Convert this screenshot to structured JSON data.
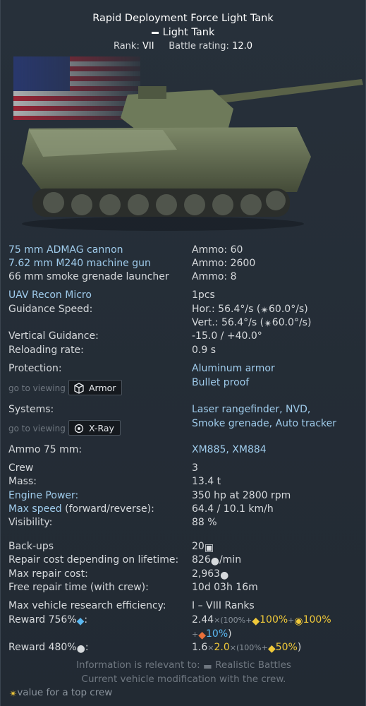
{
  "header": {
    "title": "Rapid Deployment Force Light Tank",
    "type": "Light Tank",
    "rank_label": "Rank:",
    "rank_value": "VII",
    "br_label": "Battle rating:",
    "br_value": "12.0"
  },
  "weapons": [
    {
      "name": "75 mm ADMAG cannon",
      "ammo_label": "Ammo:",
      "ammo": "60"
    },
    {
      "name": "7.62 mm M240 machine gun",
      "ammo_label": "Ammo:",
      "ammo": "2600"
    },
    {
      "name": "66 mm smoke grenade launcher",
      "ammo_label": "Ammo:",
      "ammo": "8"
    }
  ],
  "uav": {
    "name": "UAV Recon Micro",
    "count": "1pcs",
    "guidance_label": "Guidance Speed:",
    "hor": "Hor.: 56.4°/s (",
    "hor_top": "60.0°/s)",
    "vert": "Vert.: 56.4°/s (",
    "vert_top": "60.0°/s)"
  },
  "vertical_guidance": {
    "label": "Vertical Guidance:",
    "value": "-15.0 / +40.0°"
  },
  "reloading": {
    "label": "Reloading rate:",
    "value": "0.9 s"
  },
  "protection": {
    "label": "Protection:",
    "values": [
      "Aluminum armor",
      "Bullet proof"
    ]
  },
  "goto_label": "go to viewing",
  "armor_button": "Armor",
  "xray_button": "X-Ray",
  "systems": {
    "label": "Systems:",
    "values": [
      "Laser rangefinder, NVD,",
      "Smoke grenade, Auto tracker"
    ]
  },
  "ammo75": {
    "label": "Ammo 75 mm:",
    "value": "XM885, XM884"
  },
  "stats": [
    {
      "label": "Crew",
      "value": "3"
    },
    {
      "label": "Mass:",
      "value": "13.4 t"
    },
    {
      "label": "Engine Power:",
      "value": "350 hp at 2800 rpm"
    },
    {
      "label": "Max speed",
      "label_suffix": " (forward/reverse):",
      "value": "64.4 / 10.1 km/h"
    },
    {
      "label": "Visibility:",
      "value": "88 %"
    }
  ],
  "economy": {
    "backups_label": "Back-ups",
    "backups_value": "20",
    "repair_label": "Repair cost depending on lifetime:",
    "repair_value": "826",
    "repair_unit": "/min",
    "max_repair_label": "Max repair cost:",
    "max_repair_value": "2,963",
    "free_repair_label": "Free repair time (with crew):",
    "free_repair_value": "10d 03h 16m",
    "research_label": "Max vehicle research efficiency:",
    "research_value": "I – VIII Ranks",
    "reward1_label": "Reward",
    "reward1_pct": "756%",
    "reward1_colon": ":",
    "reward1_a": "2.44",
    "reward1_b": "×(100%+",
    "reward1_c": "100%",
    "reward1_d": "+",
    "reward1_e": "100%",
    "reward1_f": "+",
    "reward1_g": "10%",
    "reward1_h": ")",
    "reward2_label": "Reward",
    "reward2_pct": "480%",
    "reward2_colon": ":",
    "reward2_a": "1.6",
    "reward2_b": "×",
    "reward2_c": "2.0",
    "reward2_d": "×(100%+",
    "reward2_e": "50%",
    "reward2_f": ")"
  },
  "footer": {
    "relevant": "Information is relevant to:",
    "mode": "Realistic Battles",
    "note": "Current vehicle modification with the crew.",
    "legend": "value for a top crew"
  },
  "colors": {
    "background": "#232a33",
    "link_blue": "#9fcbeb",
    "gold": "#f0c93a",
    "cyan": "#5ab7f0"
  }
}
